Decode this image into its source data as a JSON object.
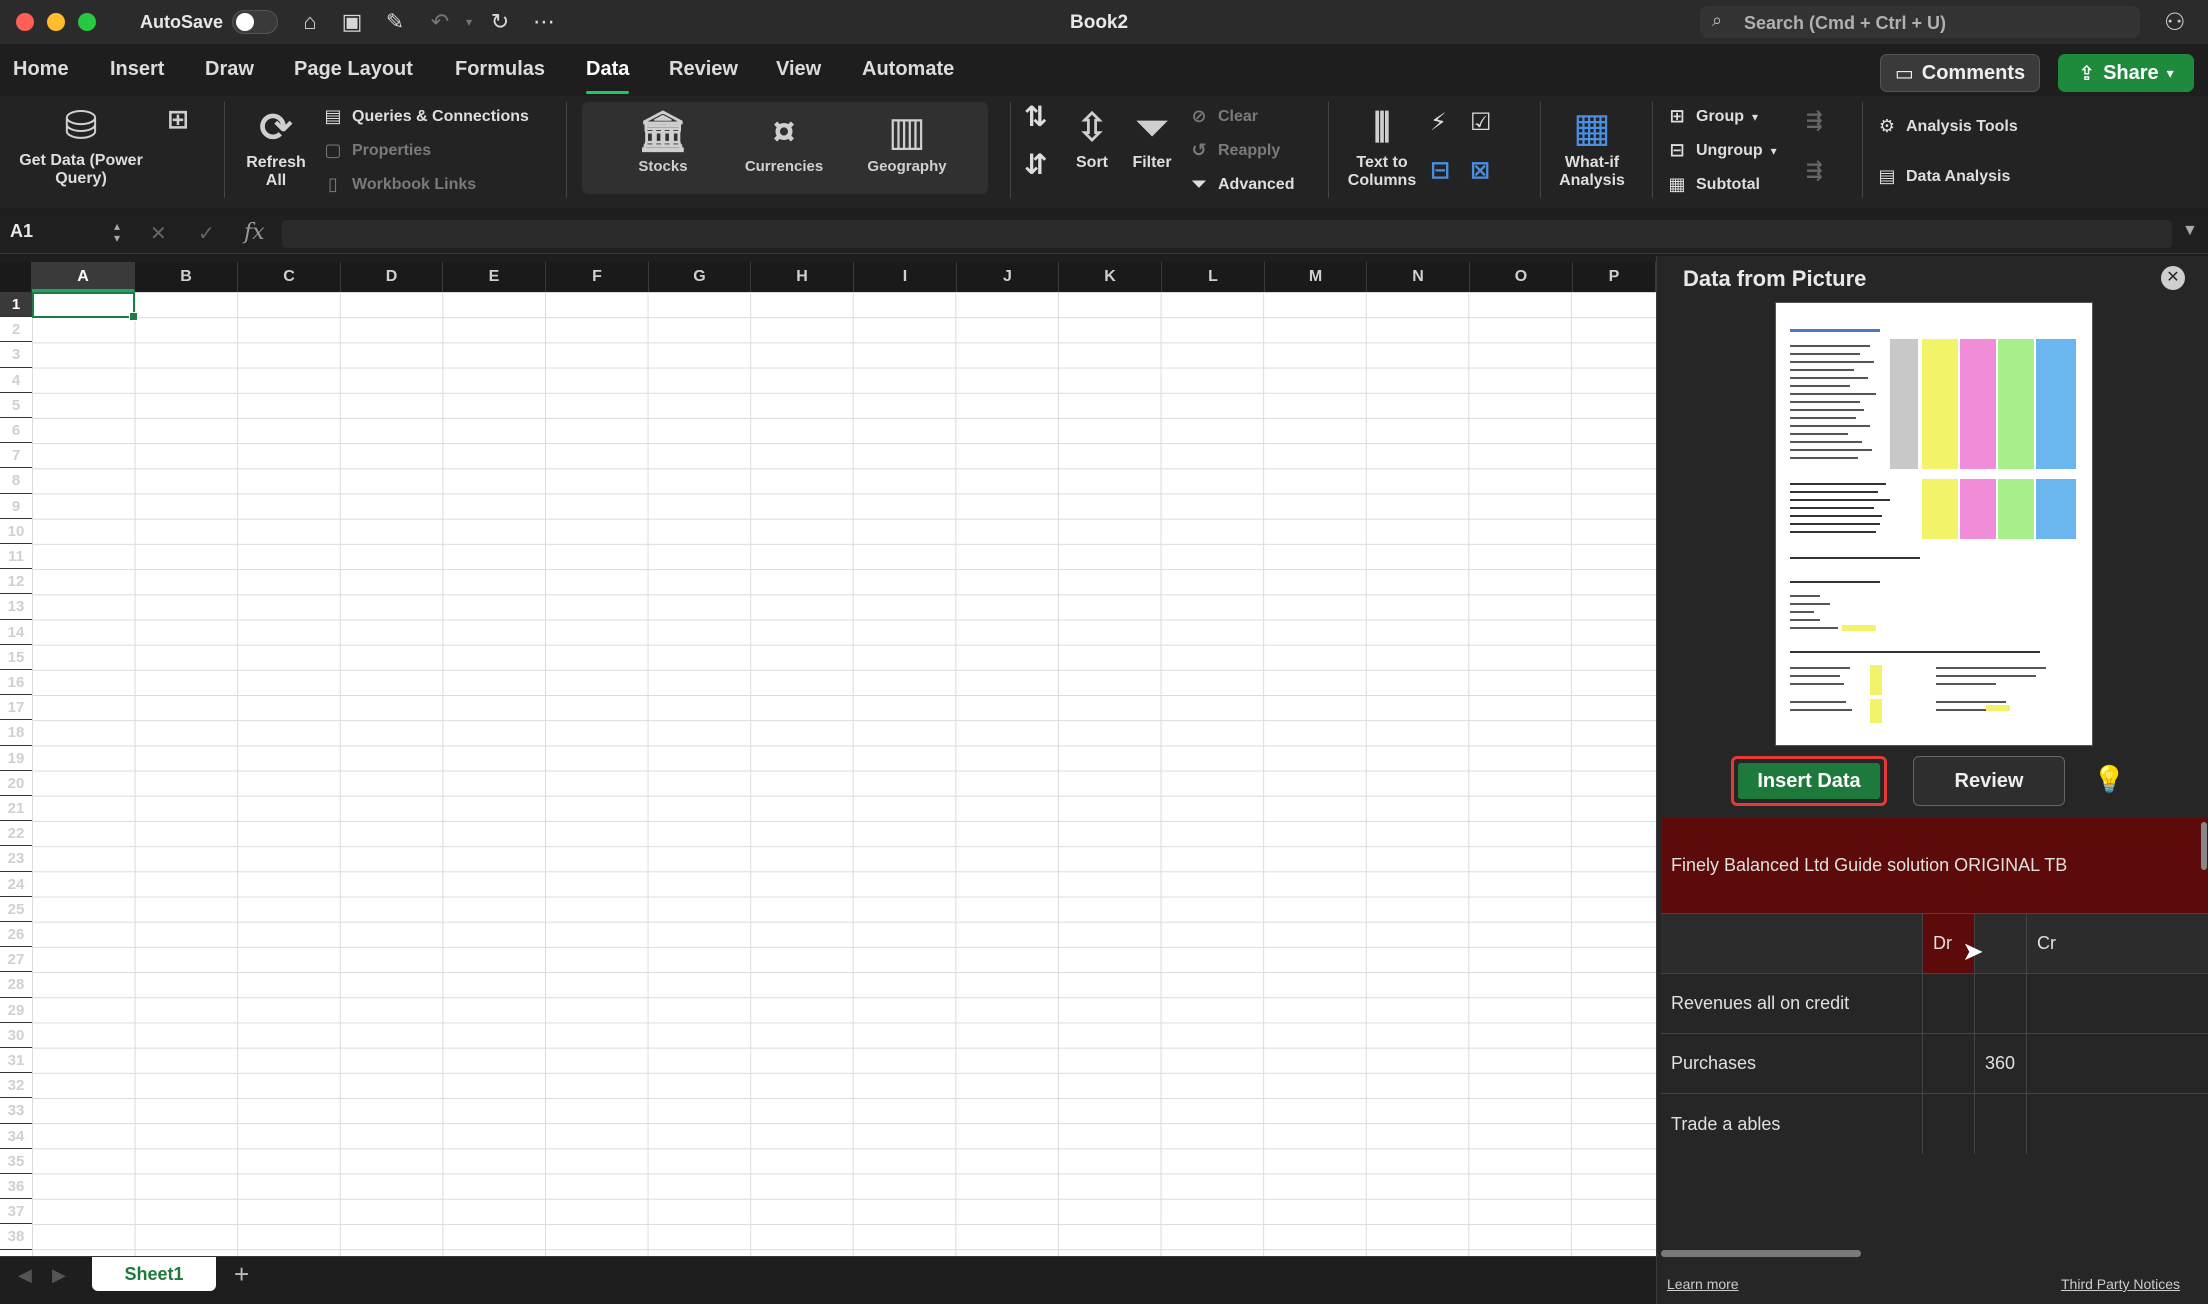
{
  "titlebar": {
    "autosave_label": "AutoSave",
    "document_title": "Book2",
    "search_placeholder": "Search (Cmd + Ctrl + U)"
  },
  "ribbon_tabs": [
    "Home",
    "Insert",
    "Draw",
    "Page Layout",
    "Formulas",
    "Data",
    "Review",
    "View",
    "Automate"
  ],
  "active_tab": "Data",
  "header_buttons": {
    "comments": "Comments",
    "share": "Share"
  },
  "ribbon": {
    "get_data": "Get Data (Power Query)",
    "refresh_all": "Refresh All",
    "queries_connections": "Queries & Connections",
    "properties": "Properties",
    "workbook_links": "Workbook Links",
    "stocks": "Stocks",
    "currencies": "Currencies",
    "geography": "Geography",
    "sort": "Sort",
    "filter": "Filter",
    "clear": "Clear",
    "reapply": "Reapply",
    "advanced": "Advanced",
    "text_to_columns": "Text to Columns",
    "what_if": "What-if Analysis",
    "group": "Group",
    "ungroup": "Ungroup",
    "subtotal": "Subtotal",
    "analysis_tools": "Analysis Tools",
    "data_analysis": "Data Analysis"
  },
  "formula_bar": {
    "name_box": "A1",
    "fx": "fx",
    "value": ""
  },
  "grid": {
    "columns": [
      "A",
      "B",
      "C",
      "D",
      "E",
      "F",
      "G",
      "H",
      "I",
      "J",
      "K",
      "L",
      "M",
      "N",
      "O",
      "P"
    ],
    "rows": [
      "1",
      "2",
      "3",
      "4",
      "5",
      "6",
      "7",
      "8",
      "9",
      "10",
      "11",
      "12",
      "13",
      "14",
      "15",
      "16",
      "17",
      "18",
      "19",
      "20",
      "21",
      "22",
      "23",
      "24",
      "25",
      "26",
      "27",
      "28",
      "29",
      "30",
      "31",
      "32",
      "33",
      "34",
      "35",
      "36",
      "37",
      "38"
    ],
    "selected_cell": "A1"
  },
  "sheets": {
    "active": "Sheet1",
    "add": "+"
  },
  "pane": {
    "title": "Data from Picture",
    "insert_button": "Insert Data",
    "review_button": "Review",
    "table_header": "Finely Balanced Ltd Guide solution ORIGINAL TB",
    "subheader": [
      "",
      "Dr",
      "",
      "Cr"
    ],
    "rows": [
      {
        "label": "Revenues all on credit",
        "c1": "",
        "c2": ""
      },
      {
        "label": "Purchases",
        "c1": "",
        "c2": "360"
      },
      {
        "label": "Trade a ables",
        "c1": "",
        "c2": ""
      }
    ],
    "learn_more": "Learn more",
    "third_party": "Third Party Notices"
  },
  "colors": {
    "accent_green": "#1e7a3c",
    "highlight_red": "#e53935",
    "header_maroon": "#5c0a0a"
  }
}
